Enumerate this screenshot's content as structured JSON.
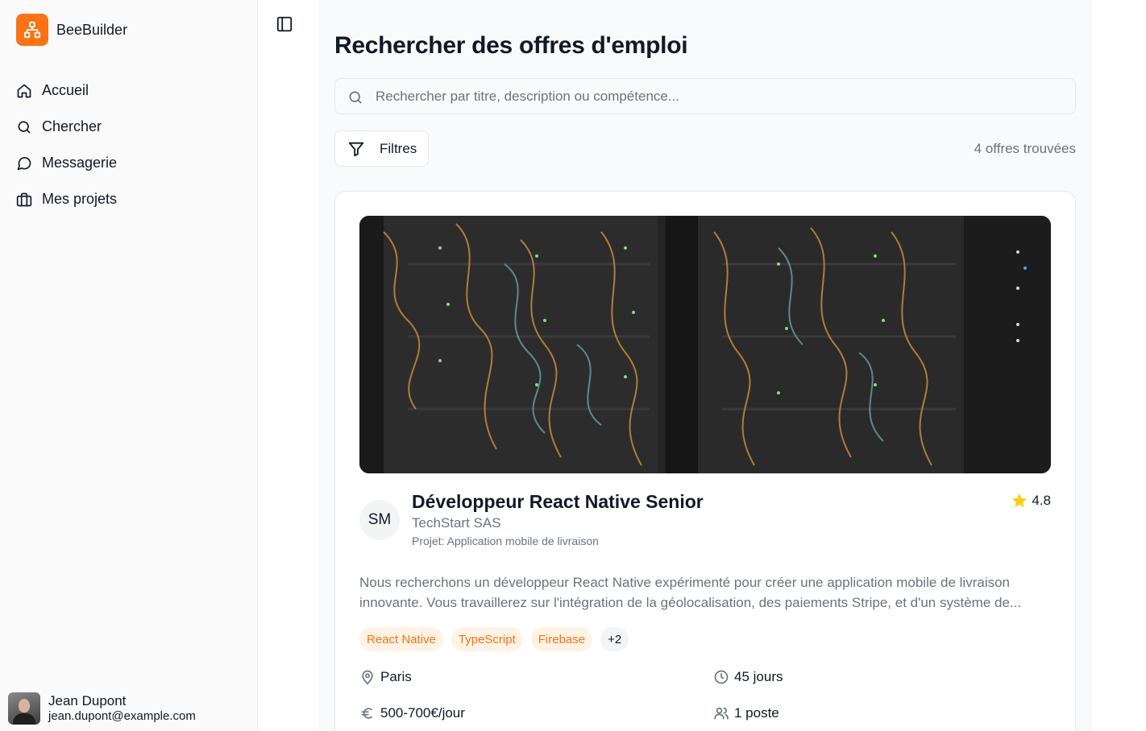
{
  "app": {
    "name": "BeeBuilder"
  },
  "sidebar": {
    "items": [
      {
        "label": "Accueil",
        "icon": "home-icon"
      },
      {
        "label": "Chercher",
        "icon": "search-icon"
      },
      {
        "label": "Messagerie",
        "icon": "message-icon"
      },
      {
        "label": "Mes projets",
        "icon": "briefcase-icon"
      }
    ]
  },
  "user": {
    "name": "Jean Dupont",
    "email": "jean.dupont@example.com"
  },
  "page": {
    "title": "Rechercher des offres d'emploi",
    "search_placeholder": "Rechercher par titre, description ou compétence...",
    "filters_label": "Filtres",
    "result_count": "4 offres trouvées"
  },
  "job": {
    "initials": "SM",
    "title": "Développeur React Native Senior",
    "company": "TechStart SAS",
    "project": "Projet: Application mobile de livraison",
    "rating": "4.8",
    "description": "Nous recherchons un développeur React Native expérimenté pour créer une application mobile de livraison innovante. Vous travaillerez sur l'intégration de la géolocalisation, des paiements Stripe, et d'un système de...",
    "tags": [
      "React Native",
      "TypeScript",
      "Firebase"
    ],
    "more_tags": "+2",
    "location": "Paris",
    "duration": "45 jours",
    "rate": "500-700€/jour",
    "positions": "1 poste"
  },
  "colors": {
    "accent": "#f97316",
    "accent_soft": "#fff3e6",
    "star": "#facc15"
  }
}
